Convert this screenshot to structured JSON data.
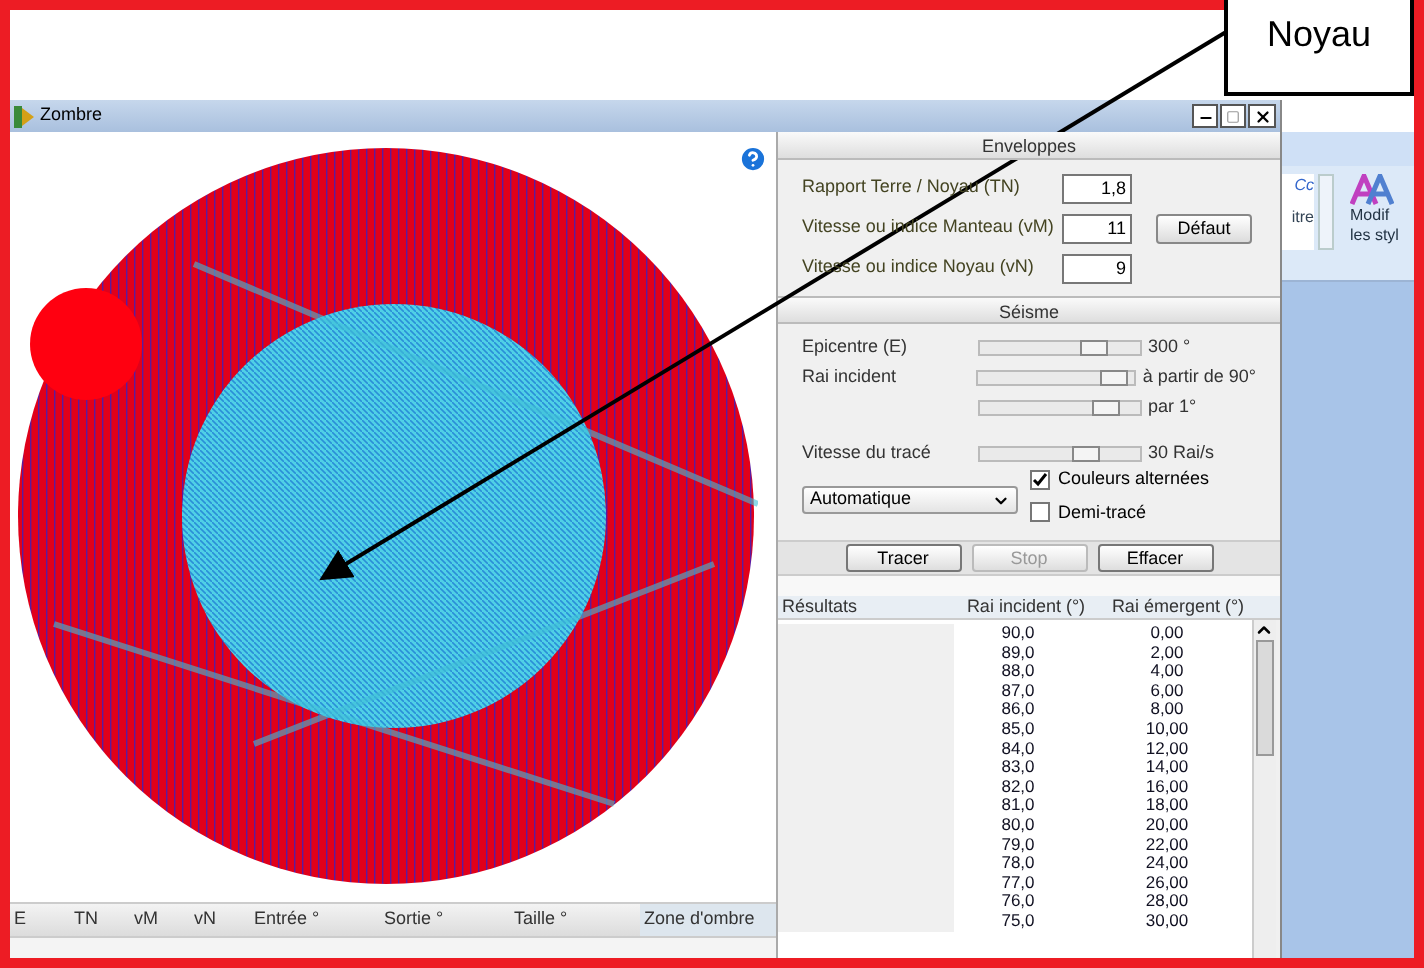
{
  "callout": {
    "label": "Noyau"
  },
  "window": {
    "title": "Zombre"
  },
  "envelopes": {
    "title": "Enveloppes",
    "fields": [
      {
        "label": "Rapport Terre / Noyau (TN)",
        "value": "1,8"
      },
      {
        "label": "Vitesse ou indice Manteau (vM)",
        "value": "11"
      },
      {
        "label": "Vitesse ou indice Noyau (vN)",
        "value": "9"
      }
    ],
    "default_button": "Défaut"
  },
  "seism": {
    "title": "Séisme",
    "sliders": [
      {
        "label": "Epicentre (E)",
        "level": 0.75,
        "reading": "300 °"
      },
      {
        "label": "Rai incident",
        "level": 0.95,
        "reading": "à partir de 90°"
      },
      {
        "level": 0.85,
        "reading": "par 1°"
      },
      {
        "label": "Vitesse du tracé",
        "level": 0.7,
        "reading": "30 Rai/s"
      }
    ],
    "mode": "Automatique",
    "checkboxes": [
      {
        "label": "Couleurs alternées",
        "checked": true
      },
      {
        "label": "Demi-tracé",
        "checked": false
      }
    ],
    "buttons": [
      {
        "label": "Tracer",
        "disabled": false
      },
      {
        "label": "Stop",
        "disabled": true
      },
      {
        "label": "Effacer",
        "disabled": false
      }
    ]
  },
  "results": {
    "columns": [
      "Résultats",
      "Rai incident (°)",
      "Rai émergent (°)"
    ],
    "rows": [
      [
        "",
        "90,0",
        "0,00"
      ],
      [
        "",
        "89,0",
        "2,00"
      ],
      [
        "",
        "88,0",
        "4,00"
      ],
      [
        "",
        "87,0",
        "6,00"
      ],
      [
        "",
        "86,0",
        "8,00"
      ],
      [
        "",
        "85,0",
        "10,00"
      ],
      [
        "",
        "84,0",
        "12,00"
      ],
      [
        "",
        "83,0",
        "14,00"
      ],
      [
        "",
        "82,0",
        "16,00"
      ],
      [
        "",
        "81,0",
        "18,00"
      ],
      [
        "",
        "80,0",
        "20,00"
      ],
      [
        "",
        "79,0",
        "22,00"
      ],
      [
        "",
        "78,0",
        "24,00"
      ],
      [
        "",
        "77,0",
        "26,00"
      ],
      [
        "",
        "76,0",
        "28,00"
      ],
      [
        "",
        "75,0",
        "30,00"
      ]
    ]
  },
  "shadow_table": {
    "columns": [
      "E",
      "TN",
      "vM",
      "vN",
      "Entrée °",
      "Sortie °",
      "Taille °",
      "Zone d'ombre"
    ]
  },
  "ribbon": {
    "style_sample": "Cc",
    "style_name": "itre",
    "button_lines": [
      "Modif",
      "les styl"
    ]
  }
}
